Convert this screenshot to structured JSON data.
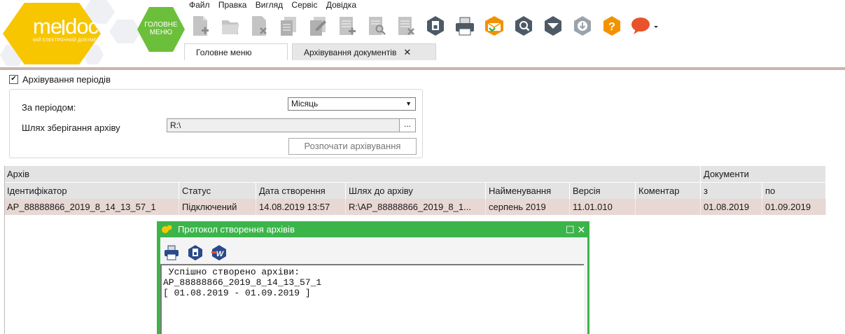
{
  "app": {
    "logo_text_1": "me",
    "logo_text_2": "doc",
    "logo_subtitle": "МІЙ ЕЛЕКТРОННИЙ ДОКУМЕНТ",
    "main_menu_tile": "ГОЛОВНЕ МЕНЮ"
  },
  "menubar": [
    "Файл",
    "Правка",
    "Вигляд",
    "Сервіс",
    "Довідка"
  ],
  "toolbar": {
    "icons": [
      "new-document-icon",
      "open-document-icon",
      "delete-document-icon",
      "copy-document-icon",
      "edit-document-icon",
      "add-row-icon",
      "find-document-icon",
      "delete-row-icon",
      "sign-document-icon",
      "print-icon",
      "send-document-icon",
      "search-registry-icon",
      "receive-document-icon",
      "download-icon",
      "help-icon",
      "chat-icon"
    ]
  },
  "tabs": [
    {
      "label": "Головне меню"
    },
    {
      "label": "Архівування документів",
      "close": "✕"
    }
  ],
  "archive_form": {
    "checkbox_label": "Архівування періодів",
    "checkbox_mark": "✔",
    "period_label": "За періодом:",
    "period_value": "Місяць",
    "path_label": "Шлях зберігання архіву",
    "path_value": "R:\\",
    "browse_label": "...",
    "start_button": "Розпочати архівування"
  },
  "grid": {
    "group_headers": {
      "archive": "Архів",
      "documents": "Документи"
    },
    "columns": [
      "Ідентифікатор",
      "Статус",
      "Дата створення",
      "Шлях до архіву",
      "Найменування",
      "Версія",
      "Коментар",
      "з",
      "по"
    ],
    "rows": [
      [
        "AP_88888866_2019_8_14_13_57_1",
        "Підключений",
        "14.08.2019 13:57",
        "R:\\AP_88888866_2019_8_1...",
        "серпень 2019",
        "11.01.010",
        "",
        "01.08.2019",
        "01.09.2019"
      ]
    ]
  },
  "protocol_window": {
    "title": "Протокол створення архівів",
    "maximize": "☐",
    "close": "✕",
    "log_lines": [
      " Успішно створено архіви:",
      "AP_88888866_2019_8_14_13_57_1",
      "[ 01.08.2019 - 01.09.2019 ]"
    ]
  },
  "colors": {
    "logo_yellow": "#f7c600",
    "main_menu_green": "#6cbf3a",
    "protocol_green": "#3bb54a",
    "selected_row": "#e8d8d4",
    "toolbar_gray": "#c4c4c4",
    "toolbar_dark": "#4d5a66",
    "accent_orange": "#f39200",
    "chat_red": "#e8532b"
  }
}
